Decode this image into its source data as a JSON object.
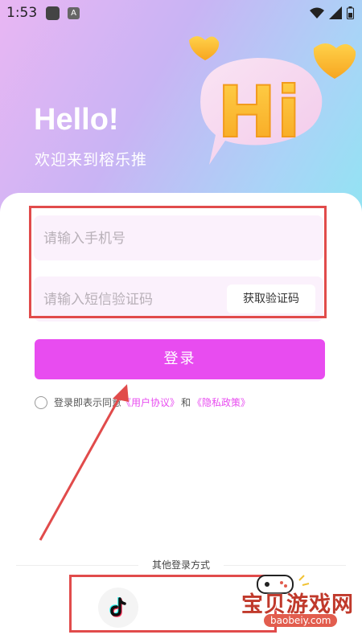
{
  "status_bar": {
    "time": "1:53",
    "app_icon_letter": "A"
  },
  "hero": {
    "hello": "Hello!",
    "welcome": "欢迎来到榕乐推",
    "art_text": "Hi"
  },
  "form": {
    "phone_placeholder": "请输入手机号",
    "code_placeholder": "请输入短信验证码",
    "get_code_label": "获取验证码",
    "login_label": "登录"
  },
  "agreement": {
    "prefix": "登录即表示同意",
    "user_agreement": "《用户协议》",
    "and": "和",
    "privacy_policy": "《隐私政策》"
  },
  "other_login": {
    "label": "其他登录方式",
    "options": [
      {
        "icon": "tiktok-icon"
      }
    ]
  },
  "watermark": {
    "title": "宝贝游戏网",
    "url": "baobeiy.com"
  },
  "colors": {
    "accent": "#E84CF0",
    "annotation_red": "#E14B4B"
  }
}
